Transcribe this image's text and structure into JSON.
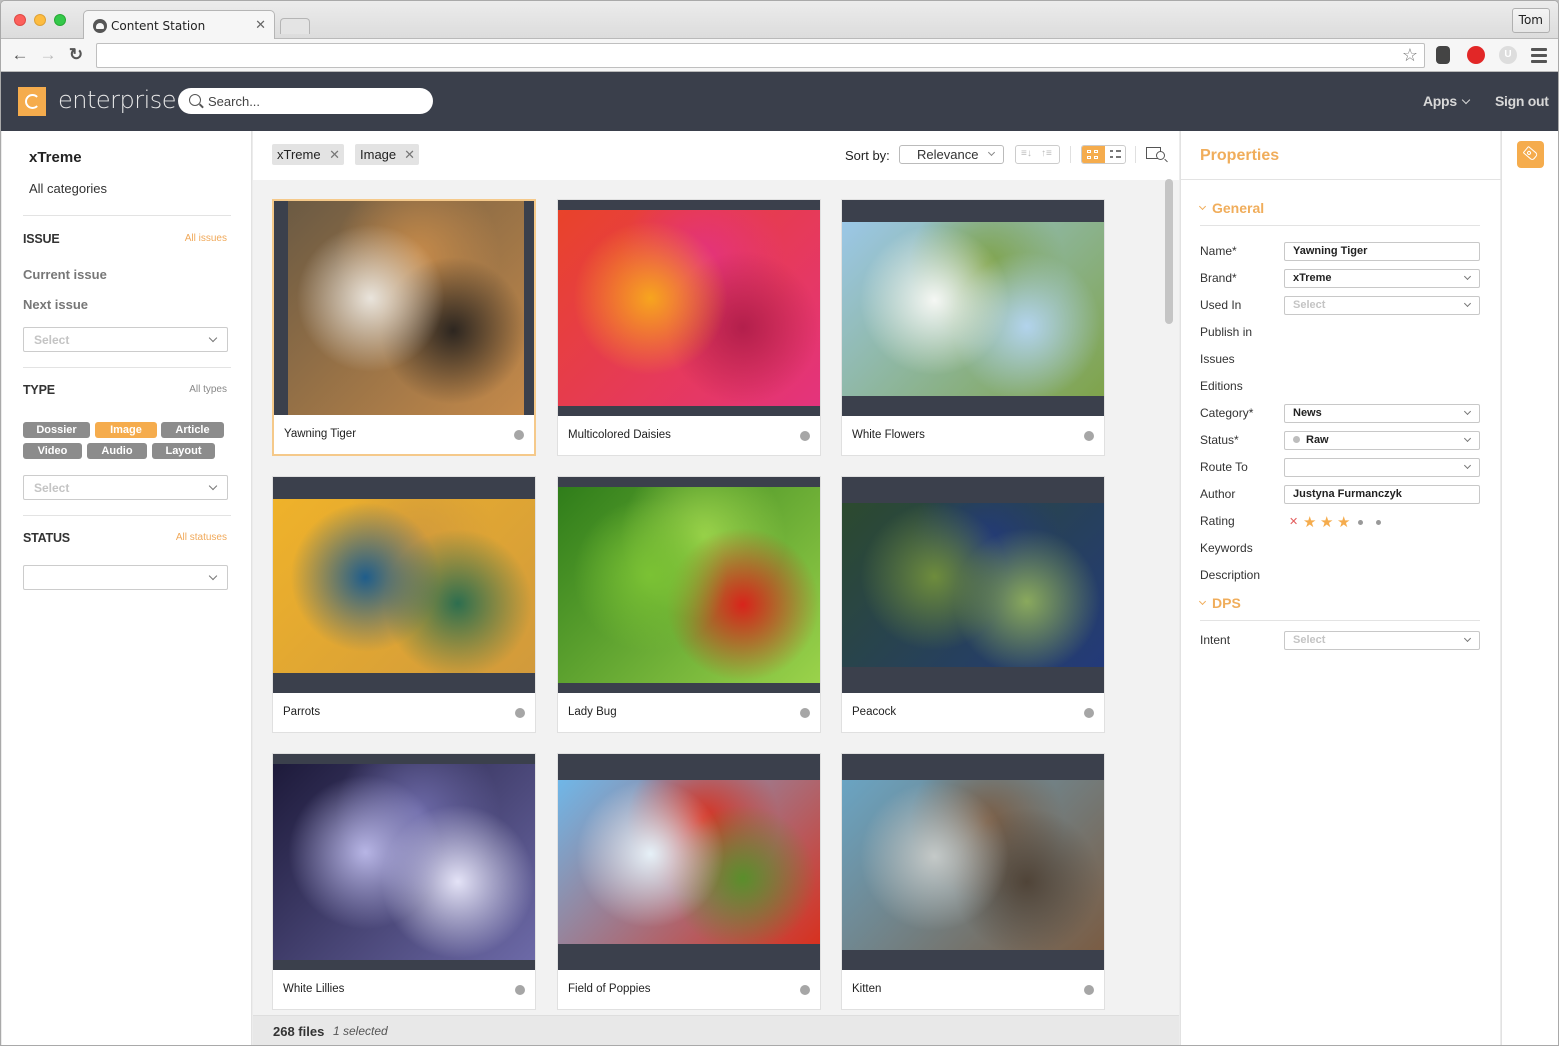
{
  "browser": {
    "tab_title": "Content Station",
    "profile": "Tom",
    "address": ""
  },
  "header": {
    "brand": "enterprise",
    "search_placeholder": "Search...",
    "apps_label": "Apps",
    "signout_label": "Sign out"
  },
  "filters": {
    "brand": "xTreme",
    "categories_label": "All categories",
    "issue": {
      "title": "ISSUE",
      "link": "All issues",
      "items": [
        "Current issue",
        "Next issue"
      ],
      "select_placeholder": "Select"
    },
    "type": {
      "title": "TYPE",
      "link": "All types",
      "pills": [
        {
          "label": "Dossier",
          "active": false
        },
        {
          "label": "Image",
          "active": true
        },
        {
          "label": "Article",
          "active": false
        },
        {
          "label": "Video",
          "active": false
        },
        {
          "label": "Audio",
          "active": false
        },
        {
          "label": "Layout",
          "active": false
        }
      ],
      "select_placeholder": "Select"
    },
    "status": {
      "title": "STATUS",
      "link": "All statuses",
      "select_value": ""
    }
  },
  "results": {
    "chips": [
      "xTreme",
      "Image"
    ],
    "sort_label": "Sort by:",
    "sort_value": "Relevance",
    "items": [
      {
        "title": "Yawning Tiger",
        "selected": true,
        "colors": [
          "#6b5a43",
          "#e9e4dc",
          "#c58a4a",
          "#2d2620"
        ]
      },
      {
        "title": "Multicolored Daisies",
        "selected": false,
        "colors": [
          "#e8432a",
          "#f7a51e",
          "#e4337d",
          "#b31f4c"
        ]
      },
      {
        "title": "White Flowers",
        "selected": false,
        "colors": [
          "#9bc7e7",
          "#f5f7f4",
          "#7fa34a",
          "#b2d3ec"
        ]
      },
      {
        "title": "Parrots",
        "selected": false,
        "colors": [
          "#efb22a",
          "#1f5d8b",
          "#d19a3c",
          "#2d6e4f"
        ]
      },
      {
        "title": "Lady Bug",
        "selected": false,
        "colors": [
          "#2f7d1a",
          "#7bc234",
          "#9bd34b",
          "#d8241b"
        ]
      },
      {
        "title": "Peacock",
        "selected": false,
        "colors": [
          "#2c4a2e",
          "#6e8c3c",
          "#233a7a",
          "#8aa95d"
        ]
      },
      {
        "title": "White Lillies",
        "selected": false,
        "colors": [
          "#1d1a3a",
          "#b7b5e5",
          "#6d6aa8",
          "#e4e3f7"
        ]
      },
      {
        "title": "Field of Poppies",
        "selected": false,
        "colors": [
          "#6fb7e8",
          "#e6f1f8",
          "#d8301e",
          "#5a8e2b"
        ]
      },
      {
        "title": "Kitten",
        "selected": false,
        "colors": [
          "#6aa4c3",
          "#c4c9c8",
          "#7a5c43",
          "#504438"
        ]
      }
    ],
    "file_count": "268 files",
    "selected_count": "1 selected"
  },
  "properties": {
    "title": "Properties",
    "general_title": "General",
    "fields": [
      {
        "label": "Name*",
        "type": "text",
        "value": "Yawning Tiger"
      },
      {
        "label": "Brand*",
        "type": "select",
        "value": "xTreme"
      },
      {
        "label": "Used In",
        "type": "select",
        "value": "",
        "placeholder": "Select"
      },
      {
        "label": "Publish in",
        "type": "none"
      },
      {
        "label": "Issues",
        "type": "none"
      },
      {
        "label": "Editions",
        "type": "none"
      },
      {
        "label": "Category*",
        "type": "select",
        "value": "News"
      },
      {
        "label": "Status*",
        "type": "select",
        "value": "Raw"
      },
      {
        "label": "Route To",
        "type": "select",
        "value": ""
      },
      {
        "label": "Author",
        "type": "text",
        "value": "Justyna Furmanczyk"
      },
      {
        "label": "Rating",
        "type": "rating"
      },
      {
        "label": "Keywords",
        "type": "none"
      },
      {
        "label": "Description",
        "type": "none"
      }
    ],
    "rating": {
      "value": 3,
      "max": 5
    },
    "dps_title": "DPS",
    "dps_fields": [
      {
        "label": "Intent",
        "type": "select",
        "value": "",
        "placeholder": "Select"
      }
    ]
  }
}
